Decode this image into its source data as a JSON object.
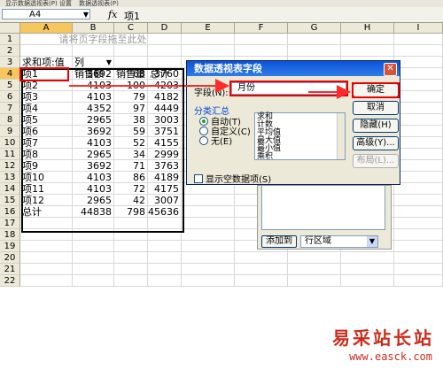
{
  "window": {
    "toolbar_left": "显示数据透视表(P)  设置",
    "toolbar_right": "数据透视表(P)"
  },
  "formula_bar": {
    "name_box": "A4",
    "fx": "fx",
    "value": "项1"
  },
  "columns": [
    "A",
    "B",
    "C",
    "D",
    "E",
    "F",
    "G",
    "H",
    "I"
  ],
  "rows": [
    "1",
    "2",
    "3",
    "4",
    "5",
    "6",
    "7",
    "8",
    "9",
    "10",
    "11",
    "12",
    "13",
    "14",
    "15",
    "16",
    "17",
    "18",
    "19",
    "20",
    "21",
    "22"
  ],
  "sheet": {
    "drop_hint": "请将页字段拖至此处",
    "pivot_header": {
      "row_field": "求和项:值",
      "col_field": "列"
    },
    "col_labels": [
      "销售额",
      "销售量",
      "总计"
    ],
    "data_rows": [
      [
        "项1",
        "3692",
        "68",
        "3760"
      ],
      [
        "项2",
        "4103",
        "100",
        "4203"
      ],
      [
        "项3",
        "4103",
        "79",
        "4182"
      ],
      [
        "项4",
        "4352",
        "97",
        "4449"
      ],
      [
        "项5",
        "2965",
        "38",
        "3003"
      ],
      [
        "项6",
        "3692",
        "59",
        "3751"
      ],
      [
        "项7",
        "4103",
        "52",
        "4155"
      ],
      [
        "项8",
        "2965",
        "34",
        "2999"
      ],
      [
        "项9",
        "3692",
        "71",
        "3763"
      ],
      [
        "项10",
        "4103",
        "86",
        "4189"
      ],
      [
        "项11",
        "4103",
        "72",
        "4175"
      ],
      [
        "项12",
        "2965",
        "42",
        "3007"
      ],
      [
        "总计",
        "44838",
        "798",
        "45636"
      ]
    ]
  },
  "dialog": {
    "title": "数据透视表字段",
    "field_label": "字段(N):",
    "field_value": "月份",
    "ok": "确定",
    "cancel": "取消",
    "hide": "隐藏(H)",
    "advanced": "高级(Y)...",
    "layout": "布局(L)...",
    "subtotal_group": "分类汇总",
    "radio_auto": "自动(T)",
    "radio_custom": "自定义(C)",
    "radio_none": "无(E)",
    "functions": [
      "求和",
      "计数",
      "平均值",
      "最大值",
      "最小值",
      "乘积"
    ],
    "show_empty": "显示空数据项(S)"
  },
  "side_panel": {
    "add_to": "添加到",
    "area": "行区域"
  },
  "watermark": {
    "text": "易采站长站",
    "url": "www.easck.com"
  },
  "colors": {
    "highlight": "#ee0000",
    "arrow": "#ff2b2b",
    "titlebar": "#0a54d8"
  }
}
